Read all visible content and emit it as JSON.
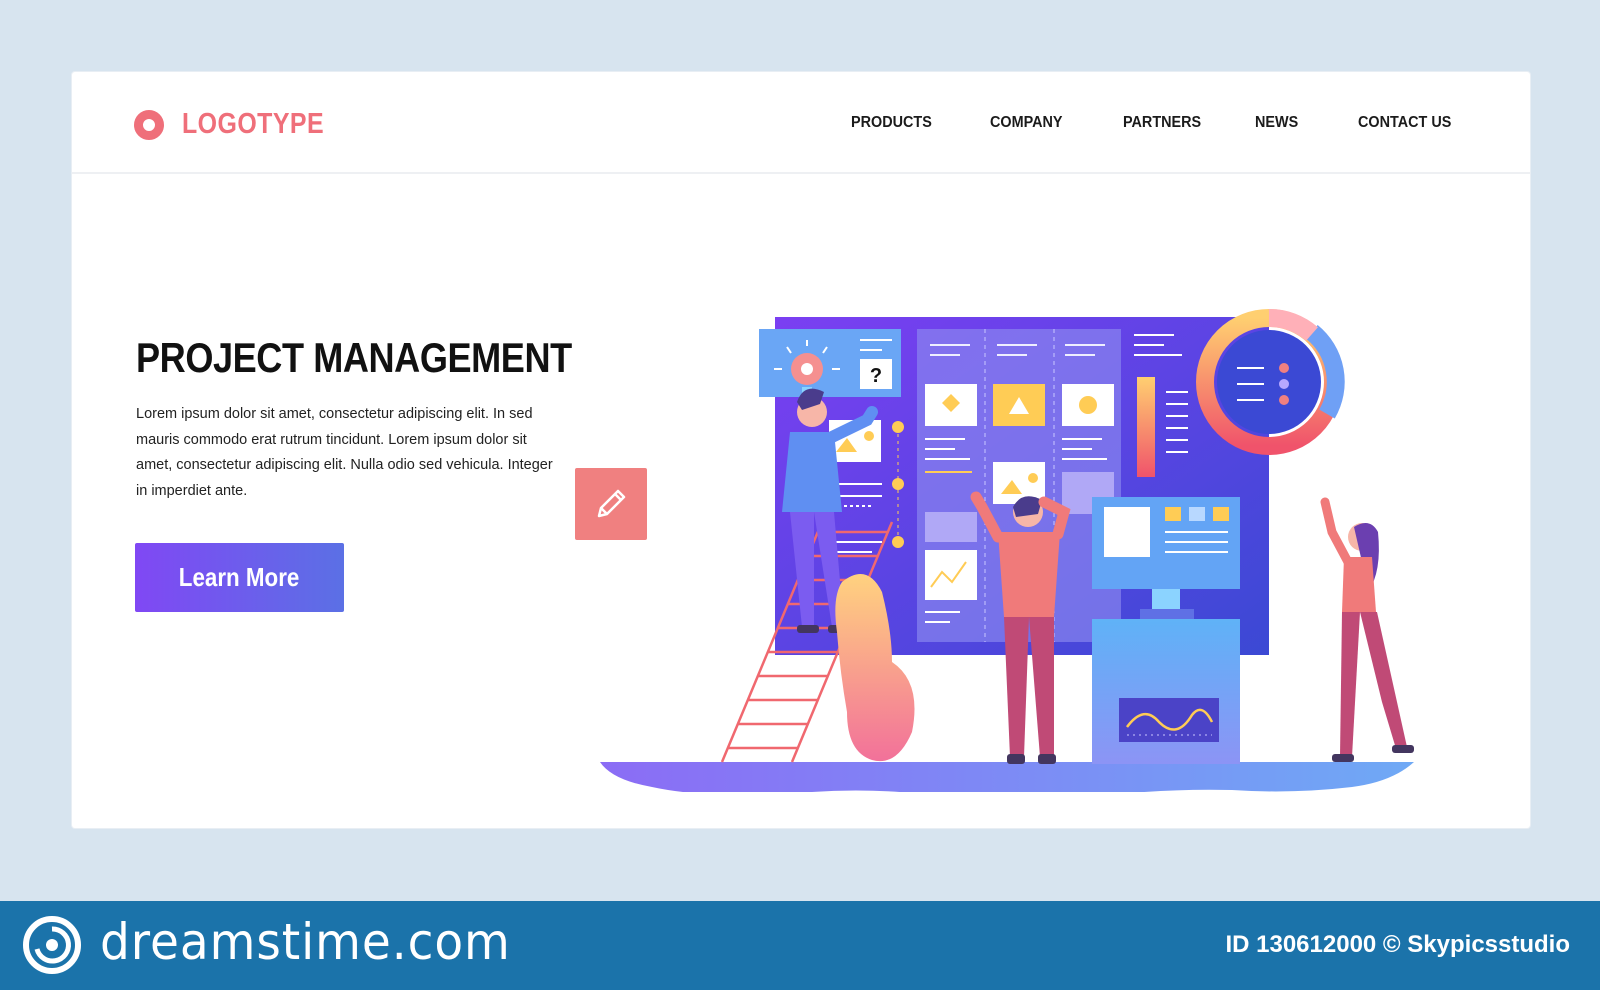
{
  "header": {
    "logo_text": "LOGOTYPE",
    "nav": [
      "PRODUCTS",
      "COMPANY",
      "PARTNERS",
      "NEWS",
      "CONTACT US"
    ]
  },
  "hero": {
    "title": "PROJECT MANAGEMENT",
    "body": "Lorem ipsum dolor sit amet, consectetur adipiscing elit. In sed mauris commodo erat rutrum tincidunt. Lorem ipsum dolor sit amet, consectetur adipiscing elit. Nulla  odio sed vehicula. Integer in imperdiet ante.",
    "button_label": "Learn More"
  },
  "illustration": {
    "help_mark": "?"
  },
  "footer": {
    "brand": "dreamstime.com",
    "image_id": "ID 130612000 © Skypicsstudio"
  },
  "colors": {
    "page_background": "#d7e4ef",
    "accent_coral": "#ef6f7a",
    "button_gradient_start": "#8048f4",
    "button_gradient_end": "#5b70e5",
    "footer_background": "#1b73aa"
  },
  "icons": [
    "logo-ring-icon",
    "pencil-icon",
    "lightbulb-icon",
    "dreamstime-logo-icon"
  ]
}
